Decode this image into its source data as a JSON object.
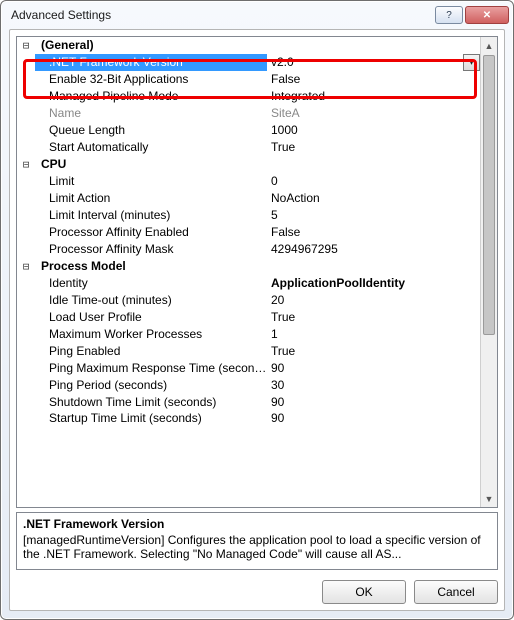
{
  "window": {
    "title": "Advanced Settings"
  },
  "categories": {
    "general": "(General)",
    "cpu": "CPU",
    "process_model": "Process Model"
  },
  "props": {
    "net_framework_version": {
      "label": ".NET Framework Version",
      "value": "v2.0"
    },
    "enable_32bit": {
      "label": "Enable 32-Bit Applications",
      "value": "False"
    },
    "managed_pipeline_mode": {
      "label": "Managed Pipeline Mode",
      "value": "Integrated"
    },
    "name": {
      "label": "Name",
      "value": "SiteA"
    },
    "queue_length": {
      "label": "Queue Length",
      "value": "1000"
    },
    "start_automatically": {
      "label": "Start Automatically",
      "value": "True"
    },
    "limit": {
      "label": "Limit",
      "value": "0"
    },
    "limit_action": {
      "label": "Limit Action",
      "value": "NoAction"
    },
    "limit_interval": {
      "label": "Limit Interval (minutes)",
      "value": "5"
    },
    "processor_affinity_enabled": {
      "label": "Processor Affinity Enabled",
      "value": "False"
    },
    "processor_affinity_mask": {
      "label": "Processor Affinity Mask",
      "value": "4294967295"
    },
    "identity": {
      "label": "Identity",
      "value": "ApplicationPoolIdentity"
    },
    "idle_timeout": {
      "label": "Idle Time-out (minutes)",
      "value": "20"
    },
    "load_user_profile": {
      "label": "Load User Profile",
      "value": "True"
    },
    "max_worker_processes": {
      "label": "Maximum Worker Processes",
      "value": "1"
    },
    "ping_enabled": {
      "label": "Ping Enabled",
      "value": "True"
    },
    "ping_max_response_time": {
      "label": "Ping Maximum Response Time (seconds)",
      "value": "90"
    },
    "ping_period": {
      "label": "Ping Period (seconds)",
      "value": "30"
    },
    "shutdown_time_limit": {
      "label": "Shutdown Time Limit (seconds)",
      "value": "90"
    },
    "startup_time_limit": {
      "label": "Startup Time Limit (seconds)",
      "value": "90"
    }
  },
  "description": {
    "title": ".NET Framework Version",
    "body": "[managedRuntimeVersion] Configures the application pool to load a specific version of the .NET Framework.  Selecting \"No Managed Code\" will cause all AS..."
  },
  "buttons": {
    "ok": "OK",
    "cancel": "Cancel"
  },
  "glyph": {
    "collapse": "⊟",
    "dropdown": "▾",
    "up": "▲",
    "down": "▼",
    "help": "?",
    "close": "✕"
  }
}
